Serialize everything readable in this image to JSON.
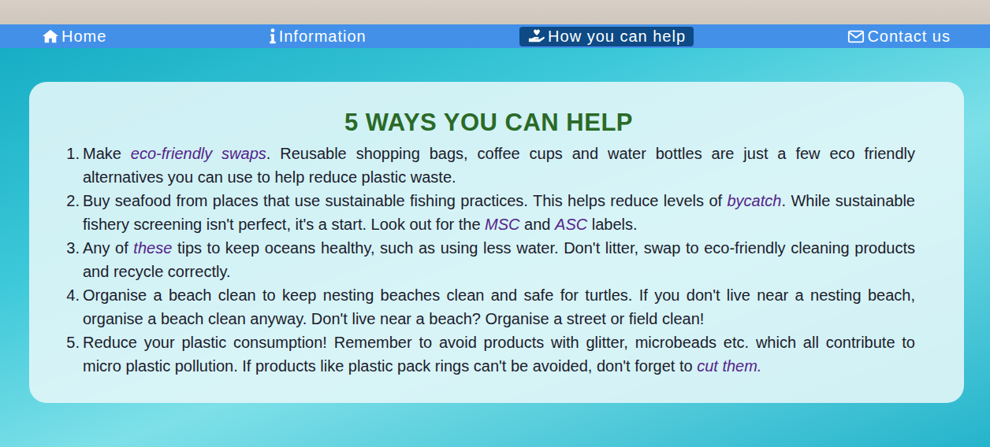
{
  "nav": {
    "items": [
      {
        "label": "Home",
        "icon": "home",
        "selected": false
      },
      {
        "label": "Information",
        "icon": "info",
        "selected": false
      },
      {
        "label": "How you can help",
        "icon": "help",
        "selected": true
      },
      {
        "label": "Contact us",
        "icon": "mail",
        "selected": false
      }
    ]
  },
  "card": {
    "title": "5 WAYS YOU CAN HELP",
    "items": [
      {
        "number": "1.",
        "segments": [
          {
            "text": "Make ",
            "link": false
          },
          {
            "text": "eco-friendly swaps",
            "link": true
          },
          {
            "text": ". Reusable shopping bags, coffee cups and water bottles are just a few eco friendly alternatives you can use to help reduce plastic waste.",
            "link": false
          }
        ]
      },
      {
        "number": "2.",
        "segments": [
          {
            "text": "Buy seafood from places that use sustainable fishing practices. This helps reduce levels of ",
            "link": false
          },
          {
            "text": "bycatch",
            "link": true
          },
          {
            "text": ". While sustainable fishery screening isn't perfect, it's a start. Look out for the ",
            "link": false
          },
          {
            "text": "MSC",
            "link": true
          },
          {
            "text": " and ",
            "link": false
          },
          {
            "text": "ASC",
            "link": true
          },
          {
            "text": " labels.",
            "link": false
          }
        ]
      },
      {
        "number": "3.",
        "segments": [
          {
            "text": "Any of ",
            "link": false
          },
          {
            "text": "these",
            "link": true
          },
          {
            "text": " tips to keep oceans healthy, such as using less water. Don't litter, swap to eco-friendly cleaning products and recycle correctly.",
            "link": false
          }
        ]
      },
      {
        "number": "4.",
        "segments": [
          {
            "text": "Organise a beach clean to keep nesting beaches clean and safe for turtles. If you don't live near a nesting beach, organise a beach clean anyway. Don't live near a beach? Organise a street or field clean!",
            "link": false
          }
        ]
      },
      {
        "number": "5.",
        "segments": [
          {
            "text": "Reduce your plastic consumption! Remember to avoid products with glitter, microbeads etc. which all contribute to micro plastic pollution. If products like plastic pack rings can't be avoided, don't forget to ",
            "link": false
          },
          {
            "text": "cut them.",
            "link": true
          }
        ]
      }
    ]
  }
}
